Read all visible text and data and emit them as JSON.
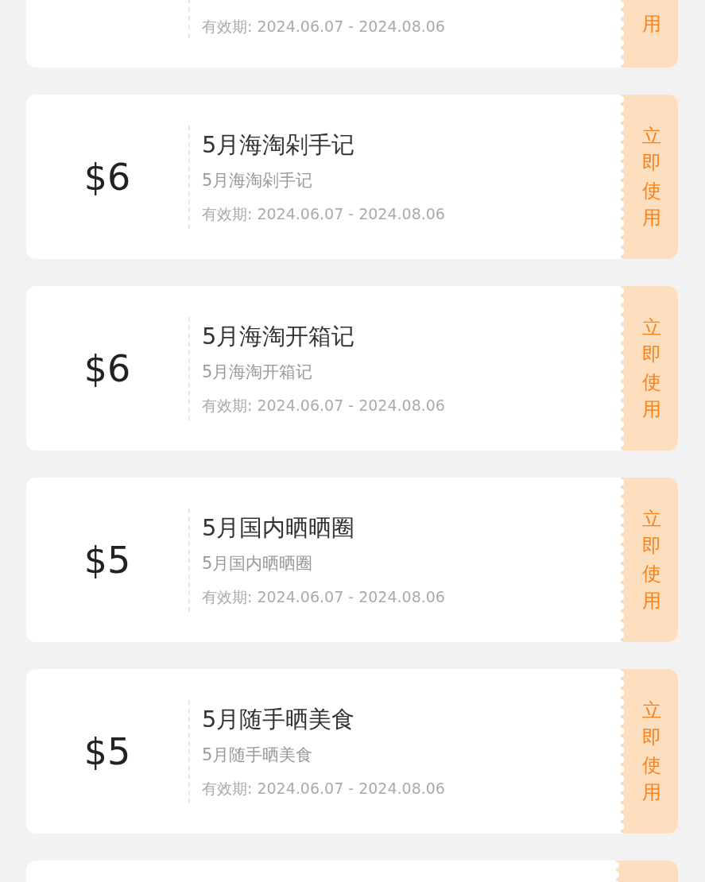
{
  "partial_coupon": {
    "validity": "有效期: 2024.06.07 - 2024.08.06",
    "action": "用"
  },
  "coupons": [
    {
      "amount": "$6",
      "title": "5月海淘剁手记",
      "subtitle": "5月海淘剁手记",
      "validity": "有效期: 2024.06.07 - 2024.08.06",
      "action": "立即使用"
    },
    {
      "amount": "$6",
      "title": "5月海淘开箱记",
      "subtitle": "5月海淘开箱记",
      "validity": "有效期: 2024.06.07 - 2024.08.06",
      "action": "立即使用"
    },
    {
      "amount": "$5",
      "title": "5月国内晒晒圈",
      "subtitle": "5月国内晒晒圈",
      "validity": "有效期: 2024.06.07 - 2024.08.06",
      "action": "立即使用"
    },
    {
      "amount": "$5",
      "title": "5月随手晒美食",
      "subtitle": "5月随手晒美食",
      "validity": "有效期: 2024.06.07 - 2024.08.06",
      "action": "立即使用"
    }
  ]
}
